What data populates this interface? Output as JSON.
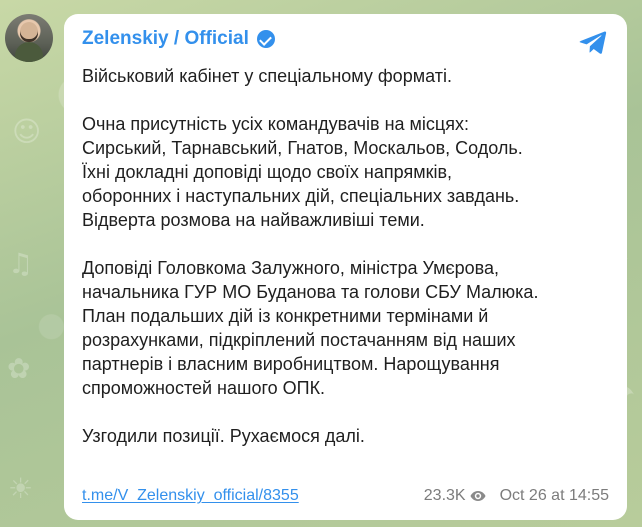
{
  "channel": {
    "name": "Zelenskiy / Official"
  },
  "message": {
    "paragraphs": [
      [
        "Військовий кабінет у спеціальному форматі."
      ],
      [
        "Очна присутність усіх командувачів на місцях:",
        "Сирський, Тарнавський, Гнатов, Москальов, Содоль.",
        "Їхні докладні доповіді щодо своїх напрямків,",
        "оборонних і наступальних дій, спеціальних завдань.",
        "Відверта розмова на найважливіші теми."
      ],
      [
        "Доповіді Головкома Залужного, міністра Умєрова,",
        "начальника ГУР МО Буданова та голови СБУ Малюка.",
        "План подальших дій із конкретними термінами й",
        "розрахунками, підкріплений постачанням від наших",
        "партнерів і власним виробництвом. Нарощування",
        "спроможностей нашого ОПК."
      ],
      [
        "Узгодили позиції. Рухаємося далі."
      ]
    ]
  },
  "footer": {
    "link": "t.me/V_Zelenskiy_official/8355",
    "views": "23.3K",
    "date": "Oct 26 at 14:55"
  },
  "icons": {
    "verified": "verified-badge-icon",
    "send": "telegram-send-icon",
    "views": "eye-icon"
  },
  "colors": {
    "accent": "#3390ec",
    "text": "#1f1f1f",
    "muted": "#7c7c7c",
    "bubble": "#ffffff"
  }
}
